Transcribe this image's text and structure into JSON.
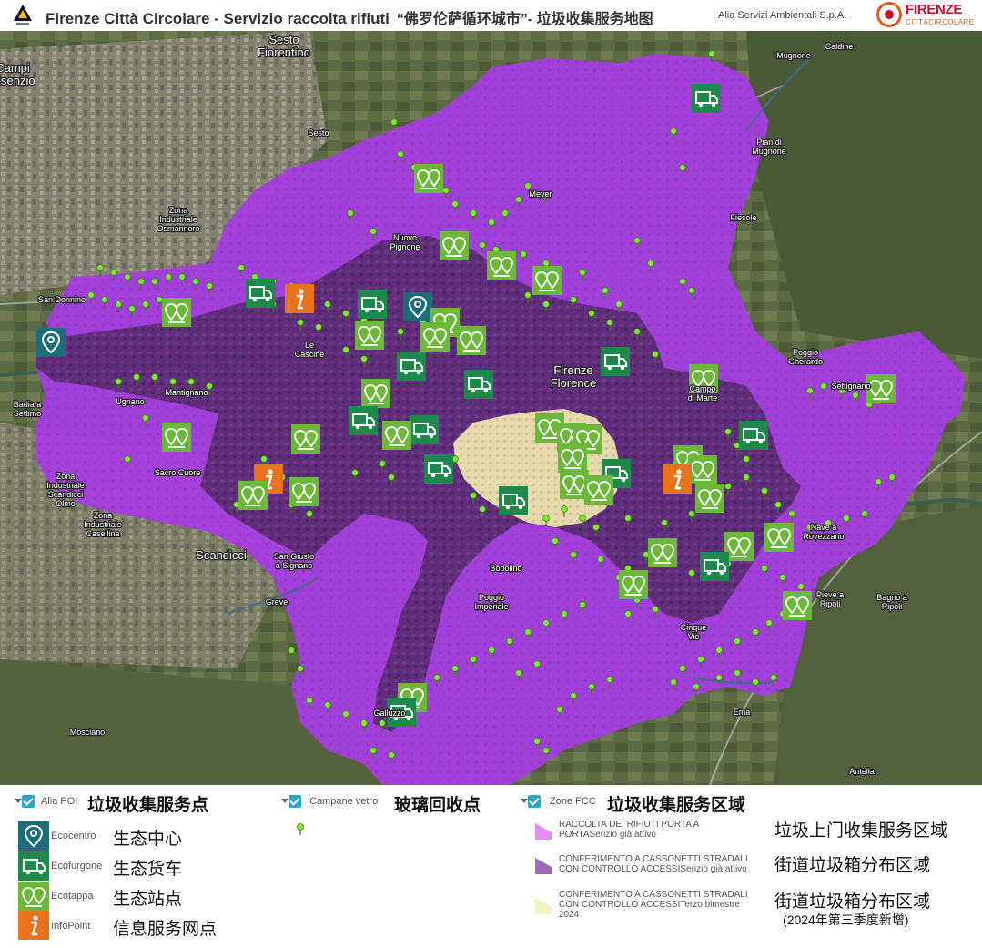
{
  "header": {
    "title_it": "Firenze Città Circolare - Servizio raccolta rifiuti",
    "title_cn": "“佛罗伦萨循环城市”- 垃圾收集服务地图",
    "organization": "Alia Servizi Ambientali S.p.A.",
    "brand_line1": "FIRENZE",
    "brand_line2": "CITTÀCIRCOLARE",
    "brand_color": "#c8102e"
  },
  "map": {
    "colors": {
      "door_to_door": "#a43ce0",
      "street_bins": "#5a2a72",
      "street_bins_2024": "#ede4b0",
      "ecocentro": "#1b6e78",
      "ecofurgone": "#1d8a4c",
      "ecotappa": "#6bb83a",
      "infopoint": "#e8731e",
      "glass_bank": "#7eea34"
    },
    "place_labels": [
      "Sesto\nFiorentino",
      "Campi\nBisenzio",
      "Sesto",
      "Caldine",
      "Mugnone",
      "Pian di\nMugnone",
      "Zona\nIndustriale\nOsmannoro",
      "Meyer",
      "Fiesole",
      "Nuovo\nPignone",
      "San Donnino",
      "Le\nCascine",
      "Firenze\nFlorence",
      "Poggio\nGherardo",
      "Settignano",
      "Badia a\nSettimo",
      "Ugnano",
      "Mantignano",
      "Campo\ndi Marte",
      "Sacro Cuore",
      "Zona\nIndustriale\nScandicci\nOlmo",
      "Zona\nIndustriale\nCasellina",
      "Scandicci",
      "San Giusto\na Signano",
      "Greve",
      "Bobolino",
      "Poggio\nImperiale",
      "Nave a\nRovezzano",
      "Pieve a\nRipoli",
      "Bagno a\nRipoli",
      "Cinque\nVie",
      "Ema",
      "Galluzzo",
      "Mosciano",
      "Antella"
    ]
  },
  "legend": {
    "poi": {
      "layer_label": "Alia POI",
      "heading_cn": "垃圾收集服务点",
      "items": [
        {
          "label": "Ecocentro",
          "cn": "生态中心",
          "icon": "pin-icon"
        },
        {
          "label": "Ecofurgone",
          "cn": "生态货车",
          "icon": "truck-icon"
        },
        {
          "label": "Ecotappa",
          "cn": "生态站点",
          "icon": "double-pin-icon"
        },
        {
          "label": "InfoPoint",
          "cn": "信息服务网点",
          "icon": "info-icon"
        }
      ]
    },
    "glass": {
      "layer_label": "Campane vetro",
      "heading_cn": "玻璃回收点"
    },
    "zones": {
      "layer_label": "Zone FCC",
      "heading_cn": "垃圾收集服务区域",
      "items": [
        {
          "line1": "RACCOLTA DEI RIFIUTI PORTA A",
          "line2": "PORTASerizio già attivo",
          "line3": "",
          "cn": "垃圾上门收集服务区域",
          "note": ""
        },
        {
          "line1": "CONFERIMENTO A CASSONETTI STRADALI",
          "line2": "CON CONTROLLO ACCESSISerizio già attivo",
          "line3": "",
          "cn": "街道垃圾箱分布区域",
          "note": ""
        },
        {
          "line1": "CONFERIMENTO A CASSONETTI STRADALI",
          "line2": "CON CONTROLLO ACCESSITerzo bimestre",
          "line3": "2024",
          "cn": "街道垃圾箱分布区域",
          "note": "(2024年第三季度新增)"
        }
      ]
    }
  }
}
